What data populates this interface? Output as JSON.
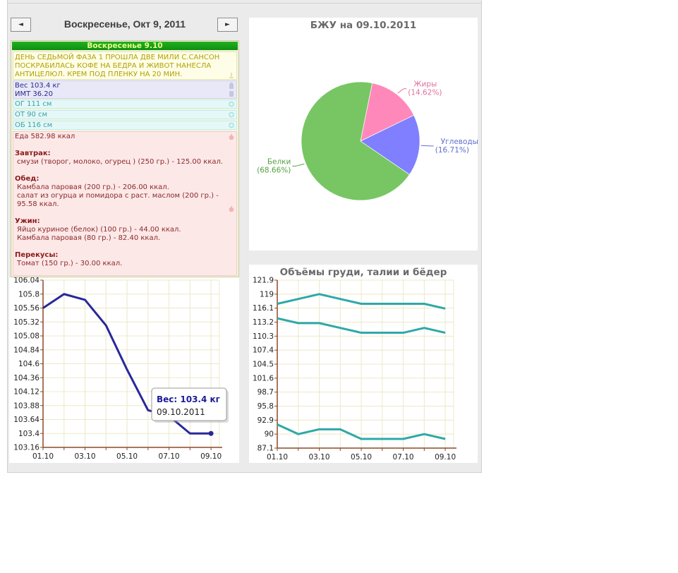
{
  "header": {
    "title": "Воскресенье, Окт 9, 2011",
    "prev_label": "◄",
    "next_label": "►"
  },
  "journal": {
    "date_label": "Воскресенье 9.10",
    "note": "ДЕНЬ СЕДЬМОЙ ФАЗА 1 ПРОШЛА ДВЕ МИЛИ С.САНСОН ПОСКРАБИЛАСЬ КОФЕ НА БЕДРА И ЖИВОТ НАНЕСЛА АНТИЦЕЛЮЛ. КРЕМ ПОД ПЛЕНКУ НА 20 МИН.",
    "weight": "Вес 103.4 кг",
    "bmi": "ИМТ 36.20",
    "chest": "ОГ 111 см",
    "waist": "ОТ 90 см",
    "hips": "ОБ 116 см",
    "food_total": "Еда 582.98 ккал",
    "meals": [
      {
        "name": "Завтрак:",
        "items": [
          "смузи (творог, молоко, огурец ) (250 гр.) - 125.00 ккал."
        ]
      },
      {
        "name": "Обед:",
        "items": [
          "Камбала паровая (200 гр.) - 206.00 ккал.",
          "салат из огурца и помидора с раст. маслом (200 гр.) - 95.58 ккал."
        ]
      },
      {
        "name": "Ужин:",
        "items": [
          "Яйцо куриное (белок) (100 гр.) - 44.00 ккал.",
          "Камбала паровая (80 гр.) - 82.40 ккал."
        ]
      },
      {
        "name": "Перекусы:",
        "items": [
          "Томат (150 гр.) - 30.00 ккал."
        ]
      }
    ]
  },
  "chart_data": [
    {
      "type": "line",
      "x": [
        "01.10",
        "02.10",
        "03.10",
        "04.10",
        "05.10",
        "06.10",
        "07.10",
        "08.10",
        "09.10"
      ],
      "tick_labels_x": [
        "01.10",
        "03.10",
        "05.10",
        "07.10",
        "09.10"
      ],
      "series": [
        {
          "values": [
            105.56,
            105.8,
            105.7,
            105.26,
            104.5,
            103.8,
            103.7,
            103.4,
            103.4
          ],
          "color": "#28289a"
        }
      ],
      "ylim": [
        103.16,
        106.04
      ],
      "yticks": [
        "106.04",
        "105.8",
        "105.56",
        "105.32",
        "105.08",
        "104.84",
        "104.6",
        "104.36",
        "104.12",
        "103.88",
        "103.64",
        "103.4",
        "103.16"
      ],
      "tooltip": {
        "value": "Вес: 103.4 кг",
        "date": "09.10.2011"
      },
      "grid": true
    },
    {
      "type": "pie",
      "title": "БЖУ на 09.10.2011",
      "slices": [
        {
          "label": "Белки",
          "pct": "(68.66%)",
          "value": 68.66,
          "color": "#77c663",
          "labelColor": "#55a040"
        },
        {
          "label": "Жиры",
          "pct": "(14.62%)",
          "value": 14.62,
          "color": "#ff88bb",
          "labelColor": "#e0709c"
        },
        {
          "label": "Углеводы",
          "pct": "(16.71%)",
          "value": 16.71,
          "color": "#7f7fff",
          "labelColor": "#5f6fd0"
        }
      ]
    },
    {
      "type": "line",
      "title": "Объёмы груди, талии и бёдер",
      "x": [
        "01.10",
        "02.10",
        "03.10",
        "04.10",
        "05.10",
        "06.10",
        "07.10",
        "08.10",
        "09.10"
      ],
      "tick_labels_x": [
        "01.10",
        "03.10",
        "05.10",
        "07.10",
        "09.10"
      ],
      "series": [
        {
          "values": [
            117,
            118,
            119,
            118,
            117,
            117,
            117,
            117,
            116
          ],
          "color": "#2ea8a8"
        },
        {
          "values": [
            114,
            113,
            113,
            112,
            111,
            111,
            111,
            112,
            111
          ],
          "color": "#2ea8a8"
        },
        {
          "values": [
            92,
            90,
            91,
            91,
            89,
            89,
            89,
            90,
            89
          ],
          "color": "#2ea8a8"
        }
      ],
      "ylim": [
        87.1,
        121.9
      ],
      "yticks": [
        "121.9",
        "119",
        "116.1",
        "113.2",
        "110.3",
        "107.4",
        "104.5",
        "101.6",
        "98.7",
        "95.8",
        "92.9",
        "90",
        "87.1"
      ],
      "grid": true
    }
  ],
  "colors": {
    "frame_bg": "#ebebeb",
    "accent_green": "#14a014"
  },
  "icons": {
    "prev": "left-triangle-icon",
    "next": "right-triangle-icon"
  }
}
